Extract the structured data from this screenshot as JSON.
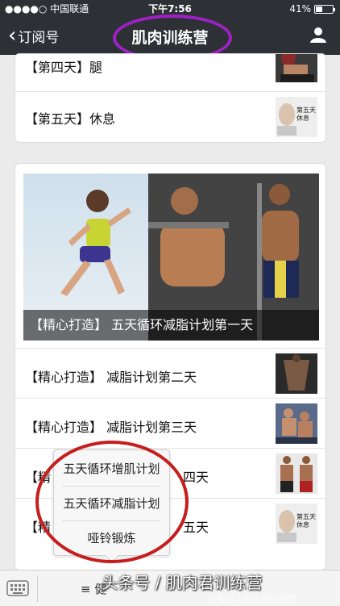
{
  "status_bar": {
    "carrier": "●●●●○ 中国联通",
    "time": "下午7:56",
    "battery": "41%",
    "battery_level": 0.41
  },
  "nav": {
    "back_label": "订阅号",
    "title": "肌肉训练营"
  },
  "card1": {
    "items": [
      {
        "label": "【第四天】腿"
      },
      {
        "label": "【第五天】休息",
        "thumb_text": "第五天\n休息"
      }
    ]
  },
  "card2": {
    "hero_caption": "【精心打造】 五天循环减脂计划第一天",
    "items": [
      {
        "label": "【精心打造】 减脂计划第二天"
      },
      {
        "label": "【精心打造】 减脂计划第三天"
      },
      {
        "label_left": "【精",
        "label_right": "四天"
      },
      {
        "label_left": "【精",
        "label_right": "五天",
        "thumb_text": "第五天\n休息"
      }
    ]
  },
  "popup_menu": {
    "items": [
      "五天循环增肌计划",
      "五天循环减脂计划",
      "哑铃锻炼"
    ]
  },
  "bottom_bar": {
    "tab_partial": "≡ 健"
  },
  "watermark": {
    "text": "头条号 / 肌肉君训练营",
    "faint": "头条号 / 肌肉君训练营"
  },
  "colors": {
    "nav_bg": "#2d3136",
    "annotation_purple": "#a020c8",
    "annotation_red": "#c41e1e"
  }
}
